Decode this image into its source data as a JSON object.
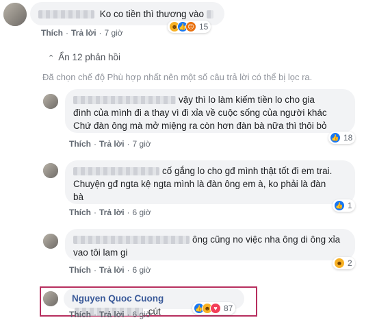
{
  "top": {
    "text": "Ko co tiền thì thương vào",
    "actions": {
      "like": "Thích",
      "reply": "Trả lời",
      "time": "7 giờ"
    },
    "reactions": {
      "icons": [
        "haha-icon",
        "like-icon",
        "angry-icon"
      ],
      "count": "15"
    }
  },
  "toggle": {
    "arrow": "⌃",
    "label": "Ẩn 12 phản hồi"
  },
  "note": "Đã chọn chế độ Phù hợp nhất nên một số câu trả lời có thể bị lọc ra.",
  "replies": [
    {
      "lines": [
        "vậy thì lo làm kiếm tiền lo cho gia",
        "đình của mình đi a thay vì đi xỉa về cuộc sống của người khác",
        "Chứ đàn ông mà mở miệng ra còn hơn đàn bà nữa thì thôi bỏ"
      ],
      "actions": {
        "like": "Thích",
        "reply": "Trả lời",
        "time": "7 giờ"
      },
      "reactions": {
        "icons": [
          "like-icon"
        ],
        "count": "18"
      }
    },
    {
      "lines": [
        "cố gắng lo cho gđ mình thật tốt đi em trai.",
        "Chuyện gđ ngta kệ ngta mình là đàn ông em à, ko phải là đàn",
        "bà"
      ],
      "actions": {
        "like": "Thích",
        "reply": "Trả lời",
        "time": "6 giờ"
      },
      "reactions": {
        "icons": [
          "like-icon"
        ],
        "count": "1"
      }
    },
    {
      "lines": [
        "ông cũng no việc nha ông di ông xỉa",
        "vao tôi lam gi"
      ],
      "actions": {
        "like": "Thích",
        "reply": "Trả lời",
        "time": "6 giờ"
      },
      "reactions": {
        "icons": [
          "haha-icon"
        ],
        "count": "2"
      }
    },
    {
      "name": "Nguyen Quoc Cuong",
      "text": "cút",
      "actions": {
        "like": "Thích",
        "reply": "Trả lời",
        "time": "6 giờ"
      },
      "reactions": {
        "icons": [
          "like-icon",
          "haha-icon",
          "love-icon"
        ],
        "count": "87"
      }
    }
  ],
  "colors": {
    "link": "#385898",
    "bubble": "#f2f3f5",
    "highlight": "#b72e5e",
    "like": "#1877f2"
  }
}
